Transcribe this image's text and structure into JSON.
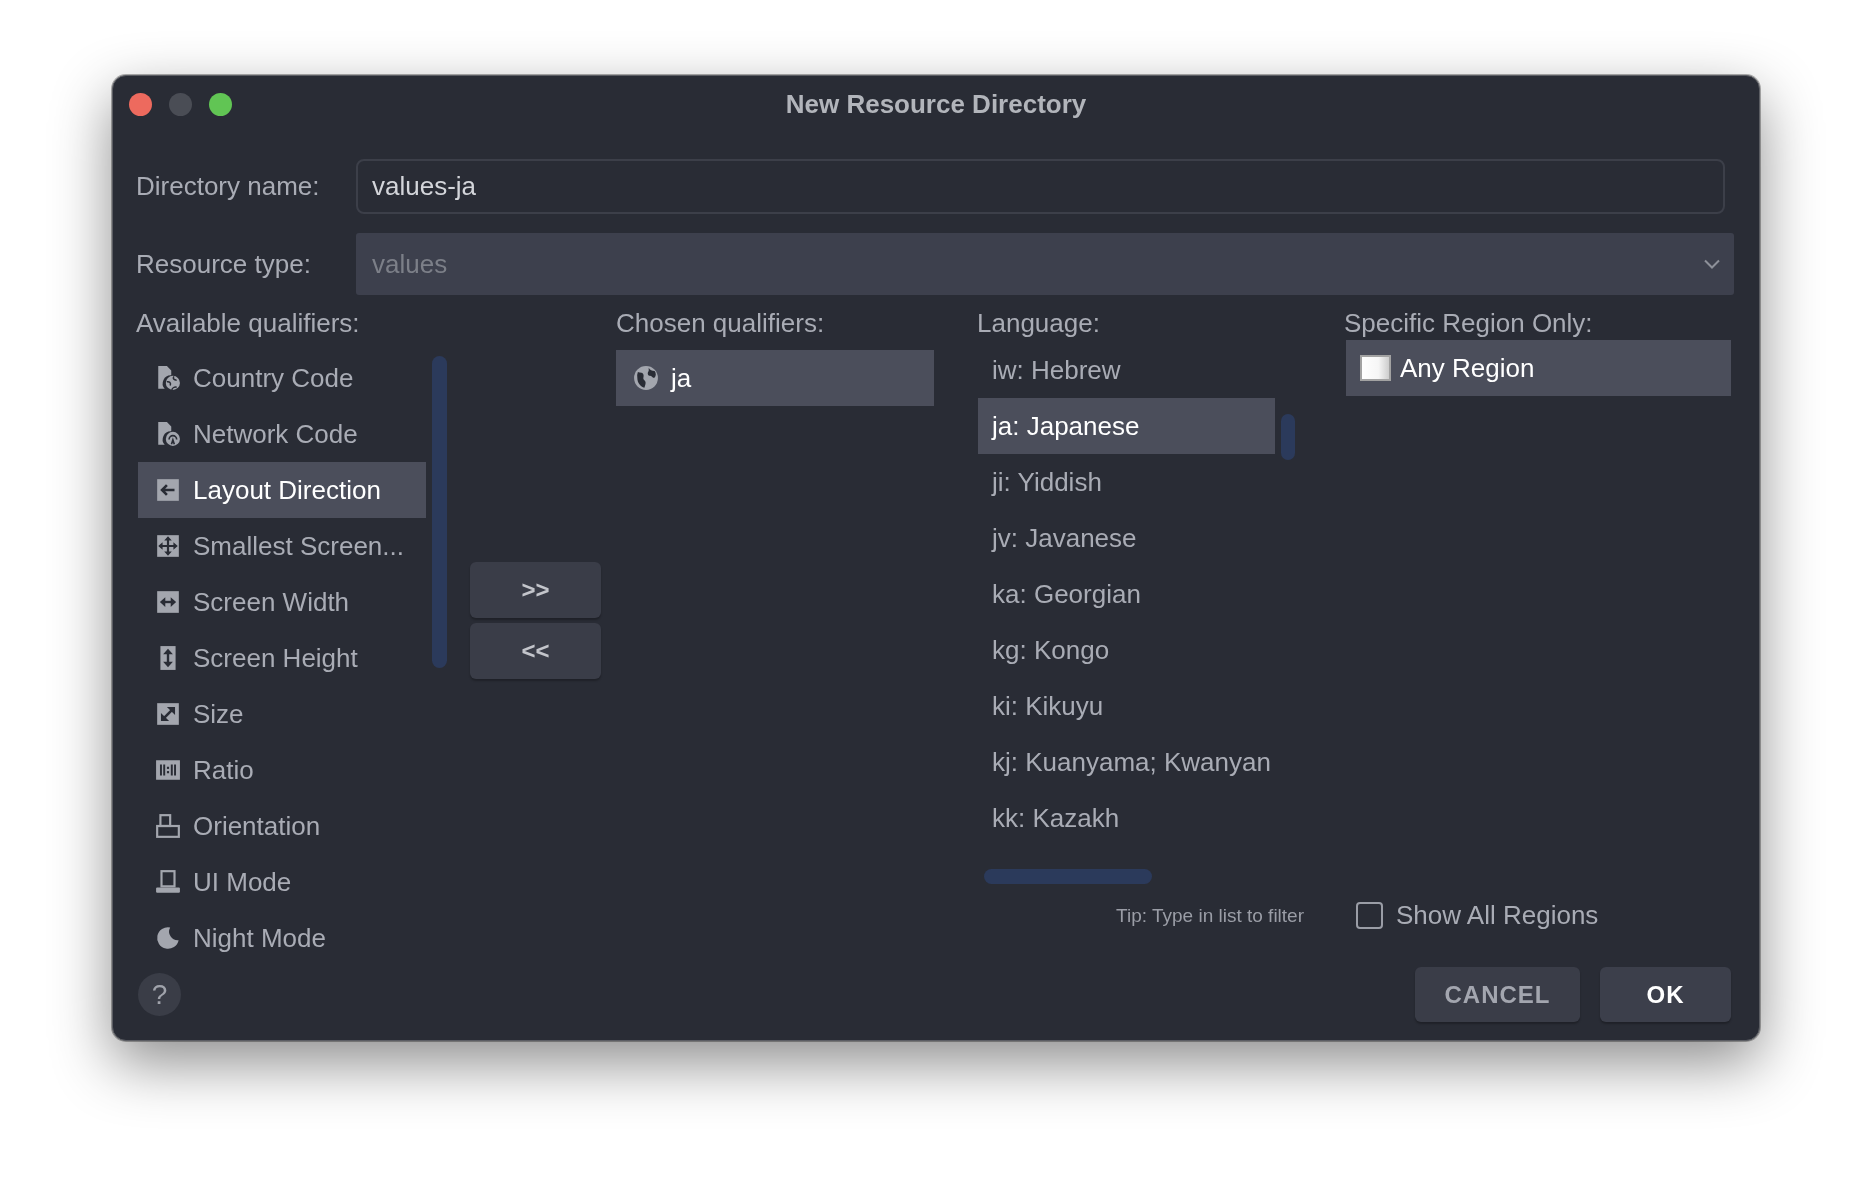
{
  "window": {
    "title": "New Resource Directory",
    "controls": [
      {
        "kind": "close",
        "disabled": false
      },
      {
        "kind": "minimize",
        "disabled": true
      },
      {
        "kind": "zoom",
        "disabled": false
      }
    ]
  },
  "directory_name": {
    "label": "Directory name:",
    "value": "values-ja"
  },
  "resource_type": {
    "label": "Resource type:",
    "value": "values",
    "disabled": true
  },
  "available_qualifiers": {
    "label": "Available qualifiers:",
    "items": [
      {
        "label": "Country Code",
        "kind": "country",
        "selected": false
      },
      {
        "label": "Network Code",
        "kind": "network",
        "selected": false
      },
      {
        "label": "Layout Direction",
        "kind": "layout",
        "selected": true
      },
      {
        "label": "Smallest Screen...",
        "kind": "smallest",
        "selected": false
      },
      {
        "label": "Screen Width",
        "kind": "width",
        "selected": false
      },
      {
        "label": "Screen Height",
        "kind": "height",
        "selected": false
      },
      {
        "label": "Size",
        "kind": "size",
        "selected": false
      },
      {
        "label": "Ratio",
        "kind": "ratio",
        "selected": false
      },
      {
        "label": "Orientation",
        "kind": "orientation",
        "selected": false
      },
      {
        "label": "UI Mode",
        "kind": "uimode",
        "selected": false
      },
      {
        "label": "Night Mode",
        "kind": "night",
        "selected": false
      }
    ]
  },
  "move_buttons": [
    ">>",
    "<<"
  ],
  "chosen_qualifiers": {
    "label": "Chosen qualifiers:",
    "items": [
      {
        "label": "ja",
        "selected": true
      }
    ]
  },
  "language": {
    "label": "Language:",
    "items": [
      {
        "label": "iw: Hebrew",
        "selected": false
      },
      {
        "label": "ja: Japanese",
        "selected": true
      },
      {
        "label": "ji: Yiddish",
        "selected": false
      },
      {
        "label": "jv: Javanese",
        "selected": false
      },
      {
        "label": "ka: Georgian",
        "selected": false
      },
      {
        "label": "kg: Kongo",
        "selected": false
      },
      {
        "label": "ki: Kikuyu",
        "selected": false
      },
      {
        "label": "kj: Kuanyama; Kwanyan",
        "selected": false
      },
      {
        "label": "kk: Kazakh",
        "selected": false
      }
    ],
    "tip": "Tip: Type in list to filter"
  },
  "region": {
    "label": "Specific Region Only:",
    "items": [
      {
        "label": "Any Region",
        "selected": true
      }
    ],
    "show_all": {
      "label": "Show All Regions",
      "checked": false
    }
  },
  "help_button": "?",
  "buttons": [
    {
      "label": "CANCEL",
      "kind": "secondary"
    },
    {
      "label": "OK",
      "kind": "primary"
    }
  ]
}
